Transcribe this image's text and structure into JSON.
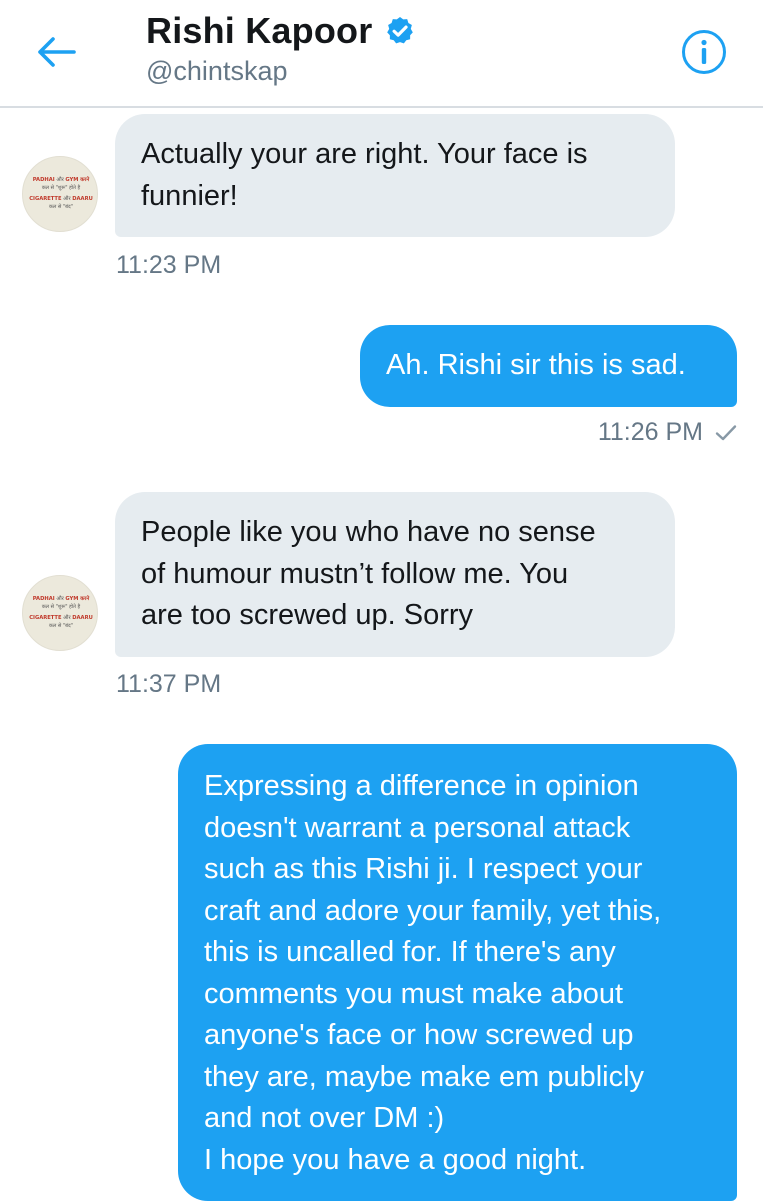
{
  "header": {
    "contact_name": "Rishi Kapoor",
    "handle": "@chintskap",
    "back_icon": "arrow-left-icon",
    "verified_icon": "verified-badge-icon",
    "info_icon": "info-circle-icon",
    "accent_color": "#1da1f2"
  },
  "avatar": {
    "lines": [
      {
        "left": "PADHAI",
        "mid": " और ",
        "right": "GYM करने"
      },
      {
        "left": "",
        "mid": "कल से \"शुरू\" होते है",
        "right": ""
      },
      {
        "left": "CIGARETTE",
        "mid": " और ",
        "right": "DAARU"
      },
      {
        "left": "",
        "mid": "कल से \"बंद\"",
        "right": ""
      }
    ]
  },
  "messages": [
    {
      "direction": "in",
      "text": "Actually your are right. Your face is\nfunnier!",
      "time": "11:23 PM"
    },
    {
      "direction": "out",
      "text": "Ah. Rishi sir this is sad.",
      "time": "11:26 PM",
      "status_icon": "sent-check-icon"
    },
    {
      "direction": "in",
      "text": "People like you who have no sense\nof humour mustn’t follow me. You\nare too screwed up. Sorry",
      "time": "11:37 PM"
    },
    {
      "direction": "out",
      "text": "Expressing a difference in opinion\ndoesn't warrant a personal attack\nsuch as this Rishi ji. I respect your\ncraft and adore your family, yet this,\nthis is uncalled for. If there's any\ncomments you must make about\nanyone's face or how screwed up\nthey are, maybe make em publicly\nand not over DM :)\nI hope you have a good night."
    }
  ]
}
